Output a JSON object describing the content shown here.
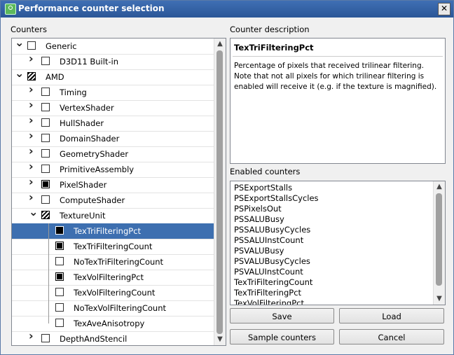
{
  "window": {
    "title": "Performance counter selection",
    "close_glyph": "✕"
  },
  "counters_label": "Counters",
  "tree": {
    "rows": [
      {
        "label": "Generic",
        "level": 0,
        "arrow": "down",
        "check": "none"
      },
      {
        "label": "D3D11 Built-in",
        "level": 1,
        "arrow": "right",
        "check": "none"
      },
      {
        "label": "AMD",
        "level": 0,
        "arrow": "down",
        "check": "partial"
      },
      {
        "label": "Timing",
        "level": 1,
        "arrow": "right",
        "check": "none"
      },
      {
        "label": "VertexShader",
        "level": 1,
        "arrow": "right",
        "check": "none"
      },
      {
        "label": "HullShader",
        "level": 1,
        "arrow": "right",
        "check": "none"
      },
      {
        "label": "DomainShader",
        "level": 1,
        "arrow": "right",
        "check": "none"
      },
      {
        "label": "GeometryShader",
        "level": 1,
        "arrow": "right",
        "check": "none"
      },
      {
        "label": "PrimitiveAssembly",
        "level": 1,
        "arrow": "right",
        "check": "none"
      },
      {
        "label": "PixelShader",
        "level": 1,
        "arrow": "right",
        "check": "checked"
      },
      {
        "label": "ComputeShader",
        "level": 1,
        "arrow": "right",
        "check": "none"
      },
      {
        "label": "TextureUnit",
        "level": 1,
        "arrow": "down",
        "check": "partial"
      },
      {
        "label": "TexTriFilteringPct",
        "level": 2,
        "arrow": "none",
        "check": "checked",
        "selected": true
      },
      {
        "label": "TexTriFilteringCount",
        "level": 2,
        "arrow": "none",
        "check": "checked"
      },
      {
        "label": "NoTexTriFilteringCount",
        "level": 2,
        "arrow": "none",
        "check": "none"
      },
      {
        "label": "TexVolFilteringPct",
        "level": 2,
        "arrow": "none",
        "check": "checked"
      },
      {
        "label": "TexVolFilteringCount",
        "level": 2,
        "arrow": "none",
        "check": "none"
      },
      {
        "label": "NoTexVolFilteringCount",
        "level": 2,
        "arrow": "none",
        "check": "none"
      },
      {
        "label": "TexAveAnisotropy",
        "level": 2,
        "arrow": "none",
        "check": "none"
      },
      {
        "label": "DepthAndStencil",
        "level": 1,
        "arrow": "right",
        "check": "none"
      }
    ]
  },
  "description_label": "Counter description",
  "description": {
    "title": "TexTriFilteringPct",
    "text": "Percentage of pixels that received trilinear filtering. Note that not all pixels for which trilinear filtering is enabled will receive it (e.g. if the texture is magnified)."
  },
  "enabled_label": "Enabled counters",
  "enabled_counters": [
    "PSExportStalls",
    "PSExportStallsCycles",
    "PSPixelsOut",
    "PSSALUBusy",
    "PSSALUBusyCycles",
    "PSSALUInstCount",
    "PSVALUBusy",
    "PSVALUBusyCycles",
    "PSVALUInstCount",
    "TexTriFilteringCount",
    "TexTriFilteringPct",
    "TexVolFilteringPct"
  ],
  "buttons": {
    "save": "Save",
    "load": "Load",
    "sample": "Sample counters",
    "cancel": "Cancel"
  },
  "scroll": {
    "up": "▲",
    "down": "▼"
  }
}
